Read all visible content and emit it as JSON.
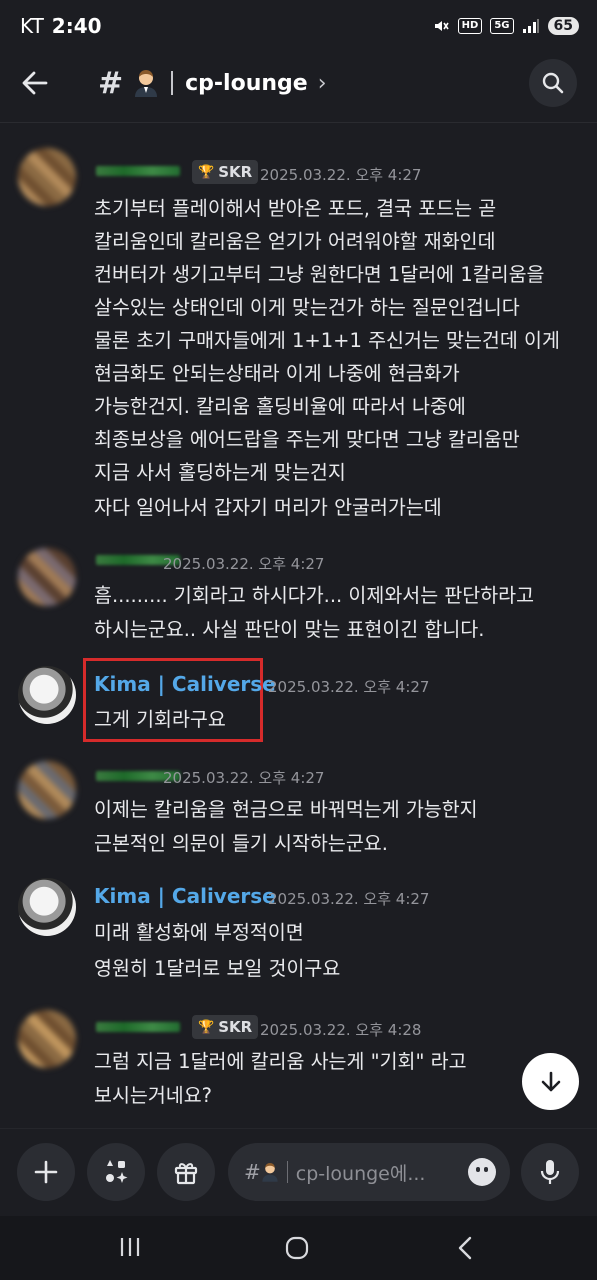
{
  "status_bar": {
    "carrier": "KT",
    "time": "2:40",
    "hd": "HD",
    "network": "5G",
    "battery": "65"
  },
  "header": {
    "hash_symbol": "#",
    "channel_name": "cp-lounge",
    "chevron": "›"
  },
  "messages": [
    {
      "role_tag": "SKR",
      "timestamp": "2025.03.22. 오후 4:27",
      "lines": [
        "초기부터 플레이해서 받아온 포드, 결국 포드는 곧",
        "칼리움인데 칼리움은 얻기가 어려워야할 재화인데",
        "컨버터가 생기고부터 그냥 원한다면 1달러에 1칼리움을",
        "살수있는 상태인데 이게 맞는건가 하는 질문인겁니다",
        "물론 초기 구매자들에게 1+1+1 주신거는 맞는건데 이게",
        "현금화도 안되는상태라 이게 나중에 현금화가",
        "가능한건지. 칼리움 홀딩비율에 따라서 나중에",
        "최종보상을 에어드랍을 주는게 맞다면 그냥 칼리움만",
        "지금 사서 홀딩하는게 맞는건지",
        "자다 일어나서 갑자기 머리가 안굴러가는데"
      ]
    },
    {
      "timestamp": "2025.03.22. 오후 4:27",
      "lines": [
        "흠......... 기회라고 하시다가... 이제와서는 판단하라고",
        "하시는군요.. 사실 판단이  맞는 표현이긴 합니다."
      ]
    },
    {
      "username": "Kima | Caliverse",
      "timestamp": "2025.03.22. 오후 4:27",
      "lines": [
        "그게 기회라구요"
      ]
    },
    {
      "timestamp": "2025.03.22. 오후 4:27",
      "lines": [
        "이제는 칼리움을 현금으로 바꿔먹는게 가능한지",
        "근본적인 의문이 들기 시작하는군요."
      ]
    },
    {
      "username": "Kima | Caliverse",
      "timestamp": "2025.03.22. 오후 4:27",
      "lines": [
        "미래 활성화에 부정적이면",
        "영원히 1달러로 보일 것이구요"
      ]
    },
    {
      "role_tag": "SKR",
      "timestamp": "2025.03.22. 오후 4:28",
      "lines": [
        "그럼 지금 1달러에 칼리움 사는게 \"기회\" 라고",
        "보시는거네요?"
      ]
    }
  ],
  "composer": {
    "hash_symbol": "#",
    "placeholder": "cp-lounge에..."
  },
  "icons": {
    "back": "arrow-left-icon",
    "search": "search-icon",
    "add": "plus-icon",
    "apps": "apps-icon",
    "gift": "gift-icon",
    "emoji": "emoji-icon",
    "mic": "microphone-icon",
    "scroll": "arrow-down-icon",
    "nav_recents": "recents-icon",
    "nav_home": "home-icon",
    "nav_back": "nav-back-icon"
  },
  "colors": {
    "background": "#1c1d22",
    "username": "#54a8e8",
    "highlight": "#d62b2b",
    "timestamp": "#94959b"
  }
}
